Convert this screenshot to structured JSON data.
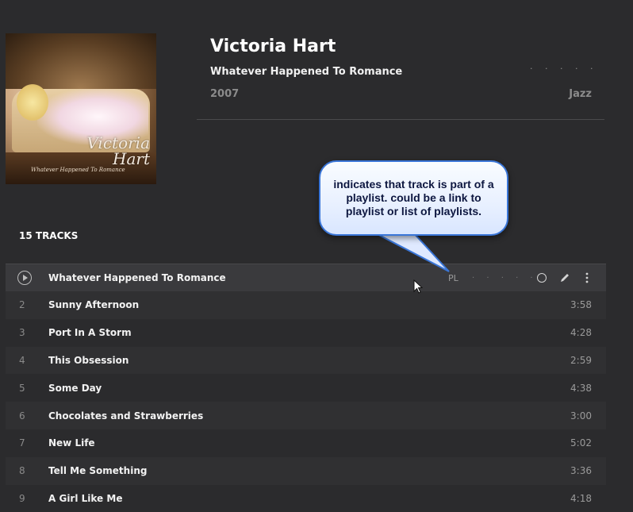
{
  "album": {
    "artist": "Victoria Hart",
    "title": "Whatever Happened To Romance",
    "year": "2007",
    "genre": "Jazz",
    "cover_script_artist": "Victoria Hart",
    "cover_script_album": "Whatever Happened To Romance"
  },
  "tracks_header": "15 TRACKS",
  "callout": {
    "text": "indicates that track is part of a playlist. could be a link to playlist or list of playlists."
  },
  "active_row": {
    "title": "Whatever Happened To Romance",
    "playlist_badge": "PL",
    "dots": "· · · · ·"
  },
  "dots_top": "· · · · ·",
  "tracks": [
    {
      "num": "2",
      "title": "Sunny Afternoon",
      "duration": "3:58"
    },
    {
      "num": "3",
      "title": "Port In A Storm",
      "duration": "4:28"
    },
    {
      "num": "4",
      "title": "This Obsession",
      "duration": "2:59"
    },
    {
      "num": "5",
      "title": "Some Day",
      "duration": "4:38"
    },
    {
      "num": "6",
      "title": "Chocolates and Strawberries",
      "duration": "3:00"
    },
    {
      "num": "7",
      "title": "New Life",
      "duration": "5:02"
    },
    {
      "num": "8",
      "title": "Tell Me Something",
      "duration": "3:36"
    },
    {
      "num": "9",
      "title": "A Girl Like Me",
      "duration": "4:18"
    }
  ],
  "icons": {
    "play": "play-circle-icon",
    "circle": "circle-icon",
    "pencil": "pencil-icon",
    "more": "more-vertical-icon"
  },
  "colors": {
    "background": "#2b2b2d",
    "callout_border": "#3a76d8",
    "text_primary": "#ffffff",
    "text_muted": "#8b8b8b"
  }
}
